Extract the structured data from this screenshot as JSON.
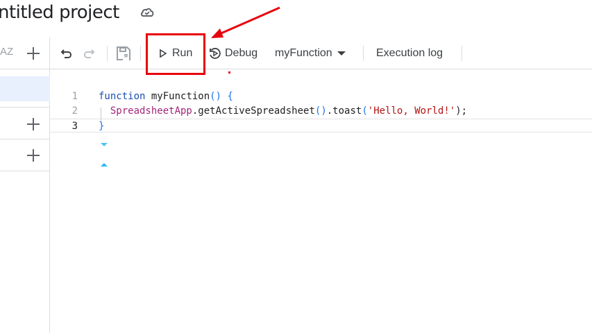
{
  "project": {
    "title": "ntitled project",
    "save_status_icon": "cloud-check-icon"
  },
  "sidebar": {
    "sort_icon_label": "AZ",
    "add_icon": "plus-icon"
  },
  "toolbar": {
    "undo_icon": "undo-icon",
    "redo_icon": "redo-icon",
    "save_icon": "save-icon",
    "run_label": "Run",
    "debug_label": "Debug",
    "function_select": "myFunction",
    "execution_log_label": "Execution log"
  },
  "editor": {
    "lines": [
      {
        "number": "1",
        "tokens": [
          {
            "t": "function",
            "c": "kw"
          },
          {
            "t": " ",
            "c": "plain"
          },
          {
            "t": "myFunction",
            "c": "fn"
          },
          {
            "t": "()",
            "c": "paren"
          },
          {
            "t": " ",
            "c": "plain"
          },
          {
            "t": "{",
            "c": "paren"
          }
        ]
      },
      {
        "number": "2",
        "tokens": [
          {
            "t": "  ",
            "c": "plain"
          },
          {
            "t": "SpreadsheetApp",
            "c": "cls"
          },
          {
            "t": ".getActiveSpreadsheet",
            "c": "plain"
          },
          {
            "t": "()",
            "c": "paren"
          },
          {
            "t": ".toast",
            "c": "plain"
          },
          {
            "t": "(",
            "c": "paren"
          },
          {
            "t": "'Hello, World!'",
            "c": "str"
          },
          {
            "t": ");",
            "c": "plain"
          }
        ]
      },
      {
        "number": "3",
        "tokens": [
          {
            "t": "}",
            "c": "paren"
          }
        ]
      }
    ],
    "active_line": "3"
  },
  "colors": {
    "highlight": "#e8000b",
    "accent": "#1a73e8",
    "selected_bg": "#e8f0fe"
  }
}
